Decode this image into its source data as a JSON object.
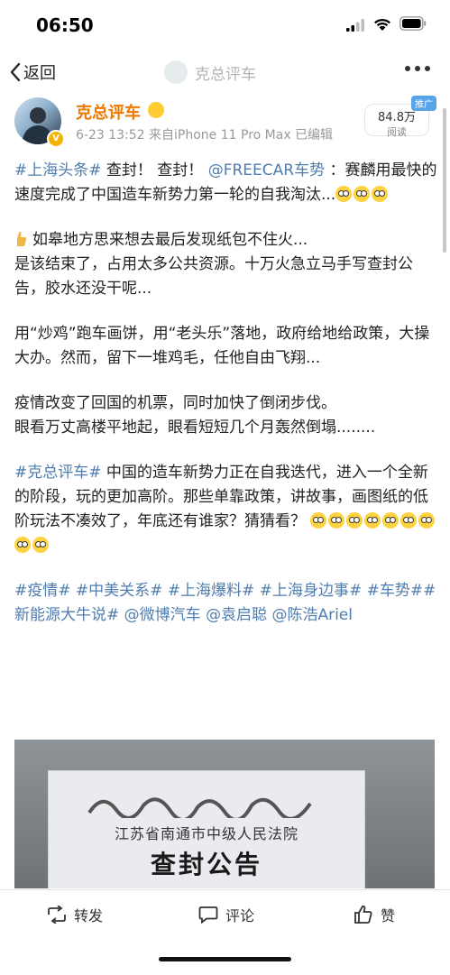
{
  "status_bar": {
    "time": "06:50"
  },
  "nav": {
    "back_label": "返回",
    "title": "克总评车"
  },
  "author": {
    "name": "克总评车",
    "date": "6-23 13:52",
    "source": "来自iPhone 11 Pro Max",
    "edited": "已编辑"
  },
  "reads": {
    "count": "84.8万",
    "label": "阅读",
    "promo_badge": "推广"
  },
  "post": {
    "p1": {
      "tag": "#上海头条#",
      "text_a": " 查封！ 查封！",
      "mention": "@FREECAR车势",
      "text_b": " ：赛麟用最快的速度完成了中国造车新势力第一轮的自我淘汰..."
    },
    "p2": {
      "line1": "如皋地方思来想去最后发现纸包不住火...",
      "line2": "是该结束了，占用太多公共资源。十万火急立马手写查封公告，胶水还没干呢..."
    },
    "p3": "用“炒鸡”跑车画饼，用“老头乐”落地，政府给地给政策，大操大办。然而，留下一堆鸡毛，任他自由飞翔...",
    "p4": {
      "line1": "疫情改变了回国的机票，同时加快了倒闭步伐。",
      "line2": "眼看万丈高楼平地起，眼看短短几个月轰然倒塌........"
    },
    "p5": {
      "tag": "#克总评车#",
      "text": " 中国的造车新势力正在自我迭代，进入一个全新的阶段，玩的更加高阶。那些单靠政策，讲故事，画图纸的低阶玩法不凑效了，年底还有谁家？猜猜看？"
    },
    "tags": [
      "#疫情#",
      "#中美关系#",
      "#上海爆料#",
      "#上海身边事#",
      "#车势##新能源大牛说#"
    ],
    "mentions": [
      "@微博汽车",
      "@袁启聪",
      "@陈浩Ariel"
    ]
  },
  "photo": {
    "court": "江苏省南通市中级人民法院",
    "title": "查封公告"
  },
  "actions": {
    "repost": "转发",
    "comment": "评论",
    "like": "赞"
  }
}
